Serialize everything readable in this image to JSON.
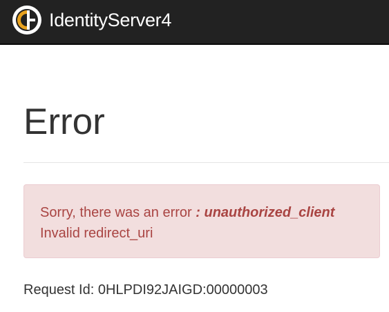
{
  "navbar": {
    "brand": "IdentityServer4",
    "logo_icon": "identityserver-logo-icon",
    "colors": {
      "background": "#222222",
      "logo_ring": "#ffffff",
      "logo_accent": "#e8a21f"
    }
  },
  "page": {
    "title": "Error"
  },
  "alert": {
    "message_prefix": "Sorry, there was an error",
    "error_code": ": unauthorized_client",
    "description": "Invalid redirect_uri",
    "colors": {
      "background": "#f2dede",
      "border": "#ebccd1",
      "text": "#a94442"
    }
  },
  "request": {
    "label": "Request Id:",
    "id": "0HLPDI92JAIGD:00000003"
  }
}
